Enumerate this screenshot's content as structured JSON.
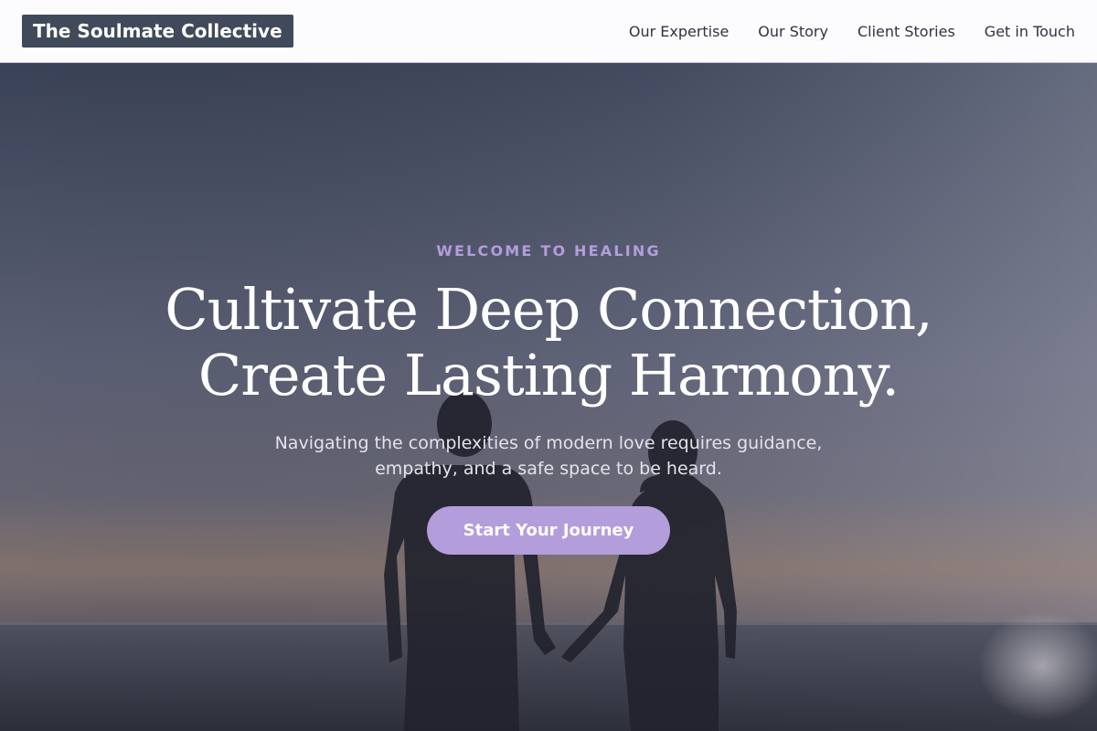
{
  "navbar": {
    "brand": "The Soulmate Collective",
    "links": [
      {
        "label": "Our Expertise"
      },
      {
        "label": "Our Story"
      },
      {
        "label": "Client Stories"
      },
      {
        "label": "Get in Touch"
      }
    ]
  },
  "hero": {
    "eyebrow": "WELCOME TO HEALING",
    "headline_line1": "Cultivate Deep Connection,",
    "headline_line2": "Create Lasting Harmony.",
    "subtext": "Navigating the complexities of modern love requires guidance, empathy, and a safe space to be heard.",
    "cta_label": "Start Your Journey",
    "background_image": "couple-holding-hands-sunset-photo"
  },
  "colors": {
    "accent": "#b39ddb",
    "brand_bg": "#414a5a",
    "nav_bg": "#fcfbfe",
    "nav_text": "#2e3440"
  }
}
